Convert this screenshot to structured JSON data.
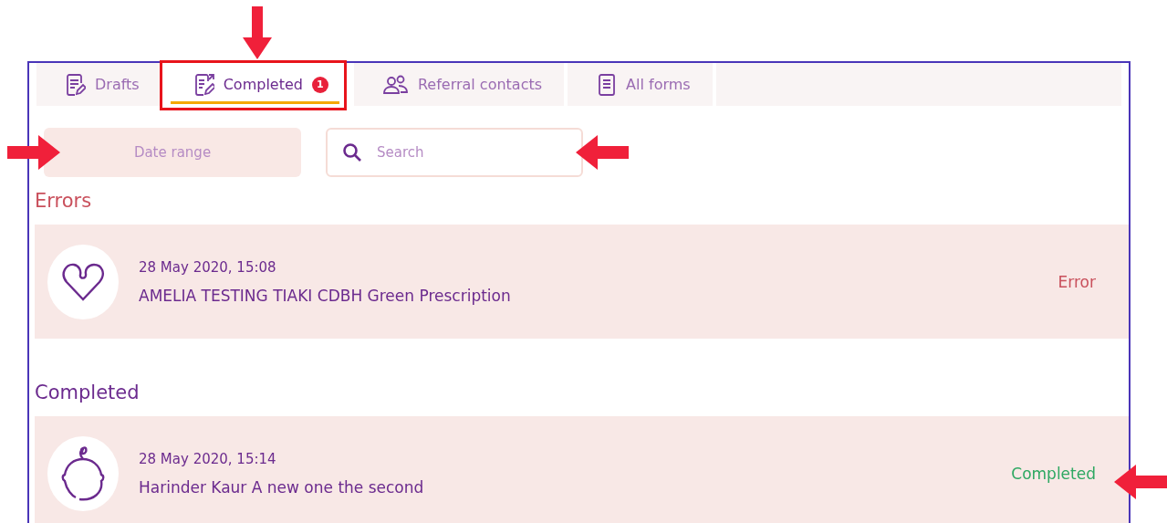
{
  "tabs": [
    {
      "label": "Drafts",
      "selected": false
    },
    {
      "label": "Completed",
      "selected": true,
      "badge": "1",
      "highlighted": true,
      "arrow_marked": true
    },
    {
      "label": "Referral contacts",
      "selected": false
    },
    {
      "label": "All forms",
      "selected": false
    }
  ],
  "filters": {
    "date_range": {
      "placeholder": "Date range",
      "arrow_marked": true
    },
    "search": {
      "placeholder": "Search",
      "arrow_marked": true
    }
  },
  "sections": [
    {
      "title": "Errors",
      "kind": "error",
      "items": [
        {
          "date": "28 May 2020, 15:08",
          "title": "AMELIA TESTING TIAKI CDBH Green Prescription",
          "status": "Error"
        }
      ]
    },
    {
      "title": "Completed",
      "kind": "completed",
      "items": [
        {
          "date": "28 May 2020, 15:14",
          "title": "Harinder Kaur A new one the second",
          "status": "Completed",
          "arrow_marked": true
        }
      ]
    }
  ]
}
